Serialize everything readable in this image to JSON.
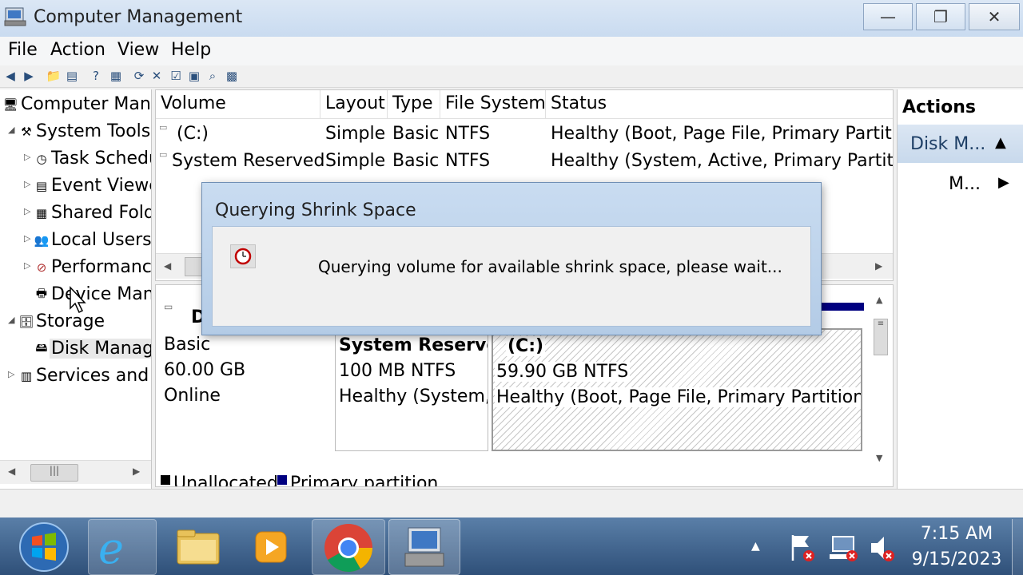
{
  "window": {
    "title": "Computer Management",
    "minimize_glyph": "—",
    "restore_glyph": "❐",
    "close_glyph": "✕"
  },
  "menu": [
    "File",
    "Action",
    "View",
    "Help"
  ],
  "tree": {
    "items": [
      {
        "label": "Computer Man"
      },
      {
        "label": "System Tools"
      },
      {
        "label": "Task Schedu"
      },
      {
        "label": "Event Viewe"
      },
      {
        "label": "Shared Fold"
      },
      {
        "label": "Local Users"
      },
      {
        "label": "Performanc"
      },
      {
        "label": "Device Man"
      },
      {
        "label": "Storage"
      },
      {
        "label": "Disk Manag"
      },
      {
        "label": "Services and A"
      }
    ]
  },
  "volume_list": {
    "columns": [
      "Volume",
      "Layout",
      "Type",
      "File System",
      "Status"
    ],
    "rows": [
      {
        "volume": "(C:)",
        "layout": "Simple",
        "type": "Basic",
        "fs": "NTFS",
        "status": "Healthy (Boot, Page File, Primary Partitio"
      },
      {
        "volume": "System Reserved",
        "layout": "Simple",
        "type": "Basic",
        "fs": "NTFS",
        "status": "Healthy (System, Active, Primary Partition"
      }
    ]
  },
  "disk": {
    "label_partial": "D",
    "type": "Basic",
    "size": "60.00 GB",
    "state": "Online",
    "partitions": [
      {
        "name": "System Reserve",
        "size": "100 MB NTFS",
        "status": "Healthy (System,"
      },
      {
        "name": "(C:)",
        "size": "59.90 GB NTFS",
        "status": "Healthy (Boot, Page File, Primary Partition)"
      }
    ],
    "legend": [
      {
        "label": "Unallocated",
        "color": "#000000"
      },
      {
        "label": "Primary partition",
        "color": "#000080"
      }
    ]
  },
  "actions": {
    "title": "Actions",
    "section": "Disk M...",
    "more": "M..."
  },
  "dialog": {
    "title": "Querying Shrink Space",
    "message": "Querying volume for available shrink space, please wait..."
  },
  "taskbar": {
    "time": "7:15 AM",
    "date": "9/15/2023"
  },
  "colors": {
    "partition_header": "#000080",
    "taskbar": "#3b5f8a"
  }
}
